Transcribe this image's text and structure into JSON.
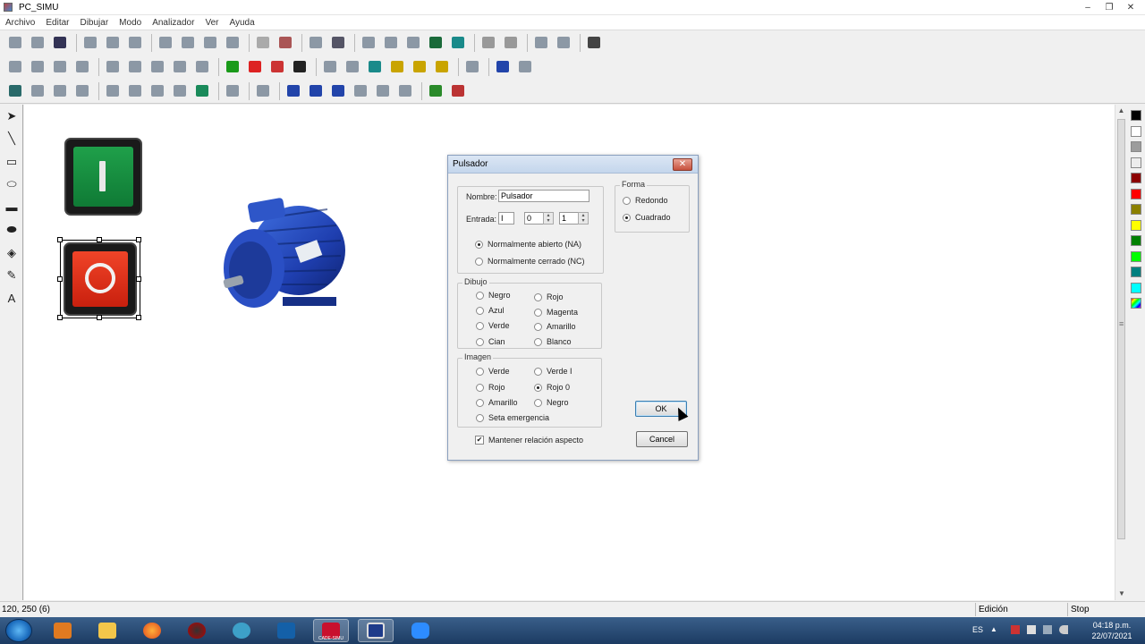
{
  "window": {
    "title": "PC_SIMU",
    "controls": [
      "–",
      "❐",
      "✕"
    ]
  },
  "menu": [
    "Archivo",
    "Editar",
    "Dibujar",
    "Modo",
    "Analizador",
    "Ver",
    "Ayuda"
  ],
  "toolbars": {
    "row1": [
      "new-file-icon",
      "open-folder-icon",
      "save-icon",
      "sep",
      "cut-icon",
      "copy-icon",
      "paste-icon",
      "sep",
      "undo-icon",
      "redo-icon",
      "group-icon",
      "ungroup-icon",
      "sep",
      "grid-icon",
      "snap-grid-icon",
      "sep",
      "pen-icon",
      "printer-icon",
      "sep",
      "cube-icon",
      "module-icon",
      "panel-icon",
      "plc-icon",
      "arduino-icon",
      "sep",
      "play-icon",
      "stop-icon",
      "sep",
      "waveform-icon",
      "graph-icon",
      "sep",
      "help-icon"
    ],
    "row2": [
      "ruler-icon",
      "blank-icon",
      "arc-icon",
      "cross-icon",
      "sep",
      "transistor-icon",
      "diode-icon",
      "resistor-icon",
      "capacitor-icon",
      "meter-icon",
      "sep",
      "green-lamp-icon",
      "battery-icon",
      "display-icon",
      "text-icon",
      "sep",
      "matrix-icon",
      "pipe-icon",
      "chart-icon",
      "gear-icon",
      "gear2-icon",
      "gear3-icon",
      "sep",
      "speaker-icon",
      "sep",
      "sensor-icon",
      "dots-icon"
    ],
    "row3": [
      "pump-icon",
      "tank-icon",
      "cylinder-icon",
      "valve-icon",
      "sep",
      "piston-icon",
      "piston2-icon",
      "fan-icon",
      "tower-icon",
      "motor-green-icon",
      "sep",
      "settings-icon",
      "sep",
      "screen-icon",
      "sep",
      "shield-icon",
      "cross-valve-icon",
      "bar-icon",
      "tree-icon",
      "hatch-icon",
      "line-icon",
      "sep",
      "traffic-icon",
      "house-icon"
    ]
  },
  "left_tools": [
    {
      "name": "pointer-tool-icon",
      "glyph": "➤"
    },
    {
      "name": "line-tool-icon",
      "glyph": "╲"
    },
    {
      "name": "rectangle-tool-icon",
      "glyph": "▭"
    },
    {
      "name": "ellipse-tool-icon",
      "glyph": "⬭"
    },
    {
      "name": "filled-rectangle-tool-icon",
      "glyph": "▬"
    },
    {
      "name": "filled-ellipse-tool-icon",
      "glyph": "⬬"
    },
    {
      "name": "fill-bucket-tool-icon",
      "glyph": "◈"
    },
    {
      "name": "brush-tool-icon",
      "glyph": "✎"
    },
    {
      "name": "text-tool-icon",
      "glyph": "A"
    }
  ],
  "palette": [
    "#000000",
    "#ffffff",
    "#9c9c9c",
    "#ececec",
    "#8b0000",
    "#ff0000",
    "#8b8000",
    "#ffff00",
    "#008000",
    "#00ff00",
    "#008080",
    "#00ffff"
  ],
  "status": {
    "coords": "120, 250 (6)",
    "mode": "Edición",
    "run_state": "Stop"
  },
  "taskbar": {
    "apps": [
      "explorer-icon",
      "media-player-icon",
      "folder-icon",
      "firefox-icon",
      "davinci-icon",
      "maps-icon",
      "vpn-icon",
      "cade-simu-icon",
      "pc-simu-icon",
      "zoom-icon"
    ],
    "cade_simu_label": "CADE-SIMU",
    "lang": "ES",
    "time": "04:18 p.m.",
    "date": "22/07/2021"
  },
  "dialog": {
    "title": "Pulsador",
    "close": "✕",
    "name_label": "Nombre:",
    "name_value": "Pulsador",
    "input_label": "Entrada:",
    "input_values": [
      "I",
      "0",
      "1"
    ],
    "contact_options": [
      {
        "label": "Normalmente abierto (NA)",
        "selected": true
      },
      {
        "label": "Normalmente cerrado (NC)",
        "selected": false
      }
    ],
    "forma": {
      "legend": "Forma",
      "options": [
        {
          "label": "Redondo",
          "selected": false
        },
        {
          "label": "Cuadrado",
          "selected": true
        }
      ]
    },
    "dibujo": {
      "legend": "Dibujo",
      "col1": [
        {
          "label": "Negro",
          "selected": false
        },
        {
          "label": "Azul",
          "selected": false
        },
        {
          "label": "Verde",
          "selected": false
        },
        {
          "label": "Cian",
          "selected": false
        }
      ],
      "col2": [
        {
          "label": "Rojo",
          "selected": false
        },
        {
          "label": "Magenta",
          "selected": false
        },
        {
          "label": "Amarillo",
          "selected": false
        },
        {
          "label": "Blanco",
          "selected": false
        }
      ]
    },
    "imagen": {
      "legend": "Imagen",
      "col1": [
        {
          "label": "Verde",
          "selected": false
        },
        {
          "label": "Rojo",
          "selected": false
        },
        {
          "label": "Amarillo",
          "selected": false
        },
        {
          "label": "Seta emergencia",
          "selected": false
        }
      ],
      "col2": [
        {
          "label": "Verde I",
          "selected": false
        },
        {
          "label": "Rojo 0",
          "selected": true
        },
        {
          "label": "Negro",
          "selected": false
        }
      ]
    },
    "keep_aspect": {
      "label": "Mantener relación aspecto",
      "checked": true
    },
    "ok": "OK",
    "cancel": "Cancel"
  }
}
